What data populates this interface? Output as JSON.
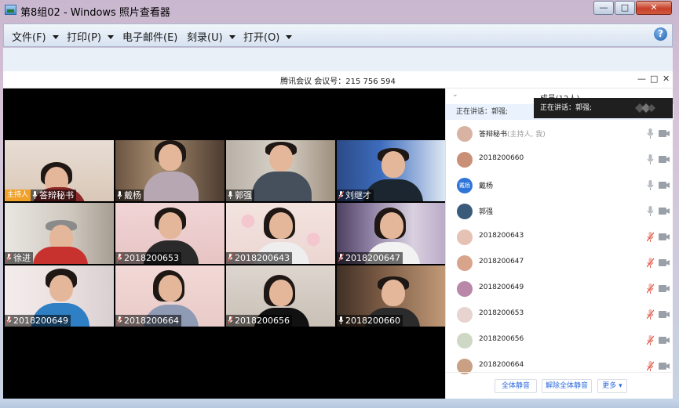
{
  "window": {
    "title": "第8组02 - Windows 照片查看器",
    "controls": {
      "minimize": "—",
      "maximize": "□",
      "close": "✕"
    }
  },
  "menubar": {
    "items": [
      {
        "label": "文件(F)",
        "has_caret": true
      },
      {
        "label": "打印(P)",
        "has_caret": true
      },
      {
        "label": "电子邮件(E)",
        "has_caret": false
      },
      {
        "label": "刻录(U)",
        "has_caret": true
      },
      {
        "label": "打开(O)",
        "has_caret": true
      }
    ],
    "help": "?"
  },
  "meeting": {
    "title": "腾讯会议 会议号：215 756 594",
    "controls": {
      "minimize": "—",
      "maximize": "□",
      "close": "✕"
    },
    "tiles": [
      {
        "label": "答辩秘书",
        "host_tag": "主持人",
        "mic": "on"
      },
      {
        "label": "戴杨",
        "mic": "on"
      },
      {
        "label": "郭强",
        "mic": "on"
      },
      {
        "label": "刘继才",
        "mic": "muted"
      },
      {
        "label": "徐进",
        "mic": "muted"
      },
      {
        "label": "2018200653",
        "mic": "muted"
      },
      {
        "label": "2018200643",
        "mic": "muted"
      },
      {
        "label": "2018200647",
        "mic": "muted"
      },
      {
        "label": "2018200649",
        "mic": "muted"
      },
      {
        "label": "2018200664",
        "mic": "muted"
      },
      {
        "label": "2018200656",
        "mic": "muted"
      },
      {
        "label": "2018200660",
        "mic": "on"
      }
    ]
  },
  "members": {
    "header": "成员(12人)",
    "speaking_bar": "正在讲话：郭强;",
    "speaking_tip": "正在讲话：郭强;",
    "list": [
      {
        "name": "答辩秘书",
        "role": "(主持人, 我)",
        "mic": "on",
        "avatar": ""
      },
      {
        "name": "2018200660",
        "role": "",
        "mic": "on",
        "avatar": ""
      },
      {
        "name": "戴杨",
        "role": "",
        "mic": "on",
        "avatar": "戴杨"
      },
      {
        "name": "郭强",
        "role": "",
        "mic": "on",
        "avatar": ""
      },
      {
        "name": "2018200643",
        "role": "",
        "mic": "muted",
        "avatar": ""
      },
      {
        "name": "2018200647",
        "role": "",
        "mic": "muted",
        "avatar": ""
      },
      {
        "name": "2018200649",
        "role": "",
        "mic": "muted",
        "avatar": ""
      },
      {
        "name": "2018200653",
        "role": "",
        "mic": "muted",
        "avatar": ""
      },
      {
        "name": "2018200656",
        "role": "",
        "mic": "muted",
        "avatar": ""
      },
      {
        "name": "2018200664",
        "role": "",
        "mic": "muted",
        "avatar": ""
      }
    ],
    "footer": {
      "mute_all": "全体静音",
      "unmute_all": "解除全体静音",
      "more": "更多 ▾"
    }
  },
  "colors": {
    "accent_blue": "#2d6be0",
    "mute_red": "#e0584a",
    "host_orange": "#f0a12a"
  }
}
